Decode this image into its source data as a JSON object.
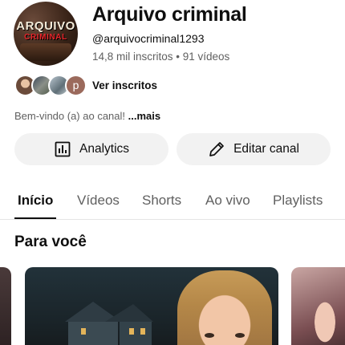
{
  "channel": {
    "avatar_logo_line1": "ARQUIVO",
    "avatar_logo_line2": "CRIMINAL",
    "title": "Arquivo criminal",
    "handle": "@arquivocriminal1293",
    "meta": "14,8 mil inscritos • 91 vídeos",
    "see_subscribers": "Ver inscritos",
    "subscriber_initial": "p",
    "description": "Bem-vindo (a) ao canal!",
    "description_more": "...mais"
  },
  "actions": {
    "analytics_label": "Analytics",
    "edit_label": "Editar canal",
    "analytics_icon": "bar-chart-icon",
    "edit_icon": "pencil-icon"
  },
  "tabs": [
    {
      "label": "Início",
      "active": true
    },
    {
      "label": "Vídeos",
      "active": false
    },
    {
      "label": "Shorts",
      "active": false
    },
    {
      "label": "Ao vivo",
      "active": false
    },
    {
      "label": "Playlists",
      "active": false
    }
  ],
  "section": {
    "title": "Para você"
  }
}
